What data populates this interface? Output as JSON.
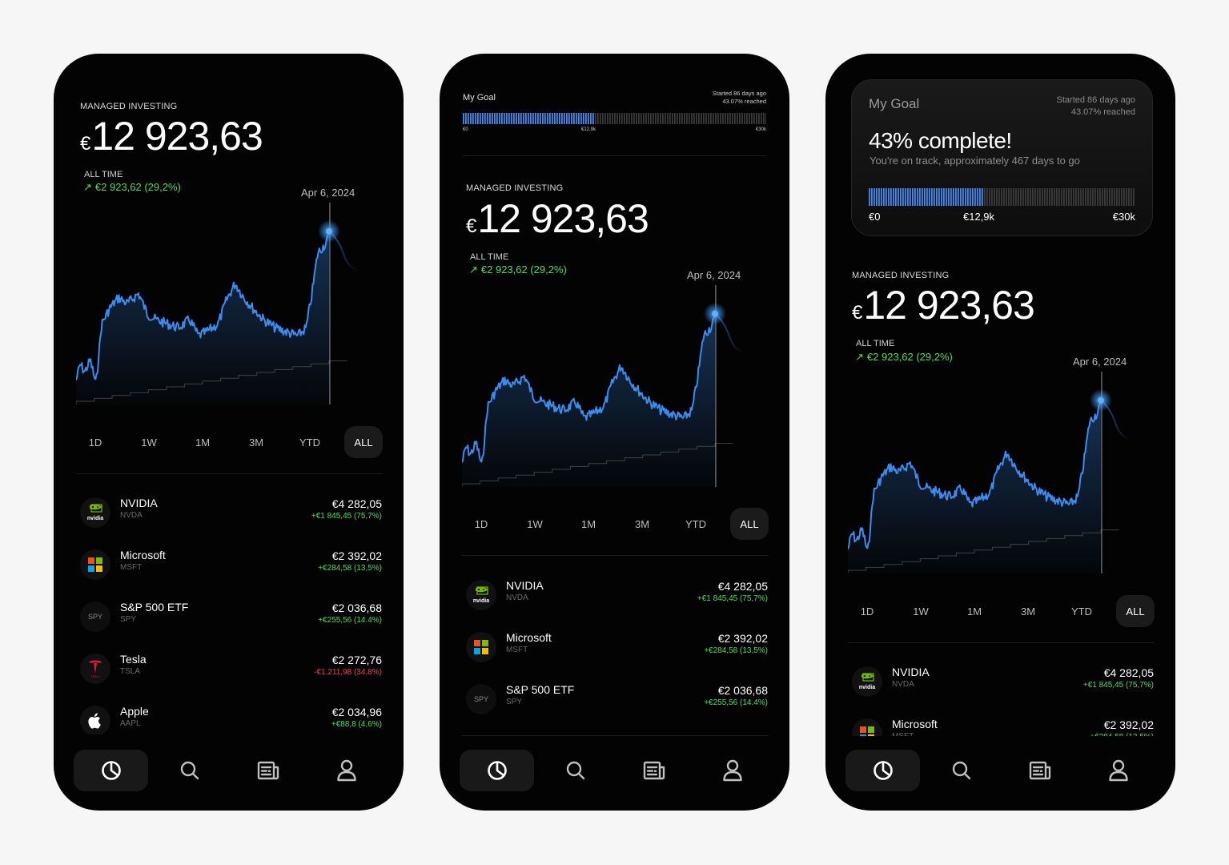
{
  "portfolio": {
    "label": "MANAGED INVESTING",
    "currency": "€",
    "balance": "12 923,63",
    "all_time_label": "ALL TIME",
    "gain": "€2 923,62  (29,2%)",
    "gain_arrow": "↗",
    "date": "Apr 6, 2024",
    "accent_color": "#3b8cf0",
    "gain_color": "#4ade60"
  },
  "ranges": [
    {
      "label": "1D",
      "active": false
    },
    {
      "label": "1W",
      "active": false
    },
    {
      "label": "1M",
      "active": false
    },
    {
      "label": "3M",
      "active": false
    },
    {
      "label": "YTD",
      "active": false
    },
    {
      "label": "ALL",
      "active": true
    }
  ],
  "holdings": [
    {
      "name": "NVIDIA",
      "ticker": "NVDA",
      "value": "€4 282,05",
      "change": "+€1 845,45 (75,7%)",
      "positive": true,
      "logo": "nvidia-logo"
    },
    {
      "name": "Microsoft",
      "ticker": "MSFT",
      "value": "€2 392,02",
      "change": "+€284,58 (13,5%)",
      "positive": true,
      "logo": "microsoft-logo"
    },
    {
      "name": "S&P 500 ETF",
      "ticker": "SPY",
      "value": "€2 036,68",
      "change": "+€255,56 (14.4%)",
      "positive": true,
      "logo": "spy-logo"
    },
    {
      "name": "Tesla",
      "ticker": "TSLA",
      "value": "€2 272,76",
      "change": "-€1,211,98 (34,8%)",
      "positive": false,
      "logo": "tesla-logo"
    },
    {
      "name": "Apple",
      "ticker": "AAPL",
      "value": "€2 034,96",
      "change": "+€88,8 (4,6%)",
      "positive": true,
      "logo": "apple-logo"
    }
  ],
  "holding_logos": {
    "spy_text": "SPY",
    "nvidia_text": "nvidia",
    "tesla_text": "TESLA"
  },
  "nav": [
    {
      "icon": "portfolio-pie-icon",
      "active": true
    },
    {
      "icon": "search-icon",
      "active": false
    },
    {
      "icon": "news-icon",
      "active": false
    },
    {
      "icon": "profile-icon",
      "active": false
    }
  ],
  "goal": {
    "title": "My Goal",
    "started": "Started 86 days ago",
    "reached": "43.07% reached",
    "progress": 0.4307,
    "headline": "43% complete!",
    "subtitle": "You're on track, approximately 467 days to go",
    "ticks": [
      "€0",
      "€12,9k",
      "€30k"
    ]
  }
}
